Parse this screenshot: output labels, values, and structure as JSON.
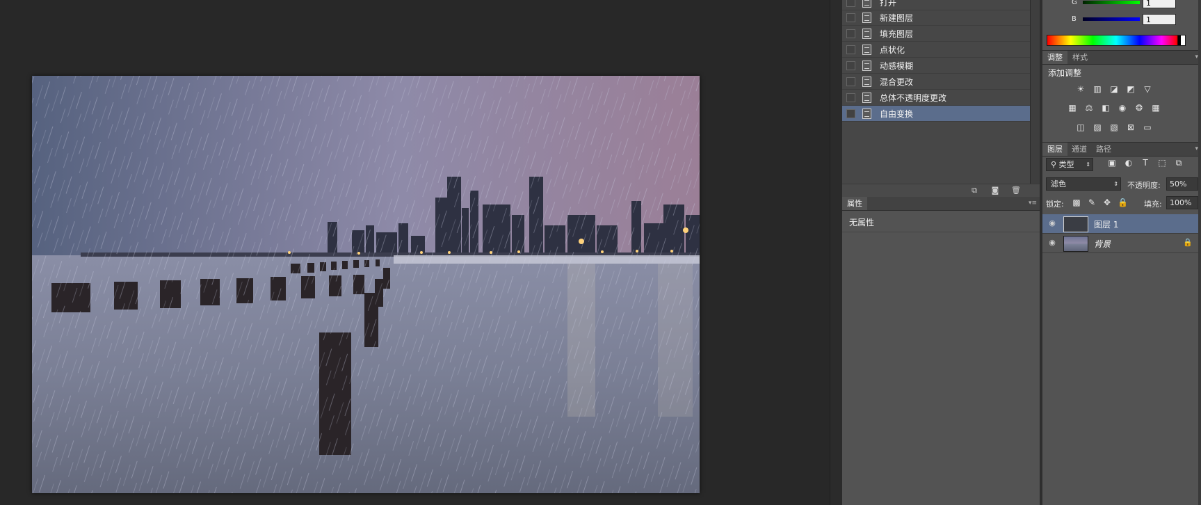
{
  "history": {
    "items": [
      {
        "label": "打开",
        "selected": false
      },
      {
        "label": "新建图层",
        "selected": false
      },
      {
        "label": "填充图层",
        "selected": false
      },
      {
        "label": "点状化",
        "selected": false
      },
      {
        "label": "动感模糊",
        "selected": false
      },
      {
        "label": "混合更改",
        "selected": false
      },
      {
        "label": "总体不透明度更改",
        "selected": false
      },
      {
        "label": "自由变换",
        "selected": true
      }
    ]
  },
  "properties": {
    "tab_label": "属性",
    "empty_text": "无属性"
  },
  "color": {
    "g_label": "G",
    "g_value": "1",
    "b_label": "B",
    "b_value": "1"
  },
  "adjustments": {
    "tabs": [
      "调整",
      "样式"
    ],
    "title": "添加调整",
    "icons_row1": [
      "brightness-contrast-icon",
      "levels-icon",
      "curves-icon",
      "exposure-icon"
    ],
    "icons_row2": [
      "vibrance-icon",
      "color-balance-icon",
      "black-white-icon",
      "photo-filter-icon",
      "channel-mixer-icon",
      "color-lookup-icon"
    ],
    "icons_row3": [
      "invert-icon",
      "posterize-icon",
      "threshold-icon",
      "selective-color-icon",
      "gradient-map-icon"
    ]
  },
  "layers": {
    "tabs": [
      "图层",
      "通道",
      "路径"
    ],
    "filter_label": "类型",
    "blend_mode": "滤色",
    "opacity_label": "不透明度:",
    "opacity_value": "50%",
    "lock_label": "锁定:",
    "fill_label": "填充:",
    "fill_value": "100%",
    "items": [
      {
        "name": "图层 1",
        "selected": true,
        "visible": true,
        "locked": false
      },
      {
        "name": "背景",
        "selected": false,
        "visible": true,
        "locked": true
      }
    ]
  }
}
